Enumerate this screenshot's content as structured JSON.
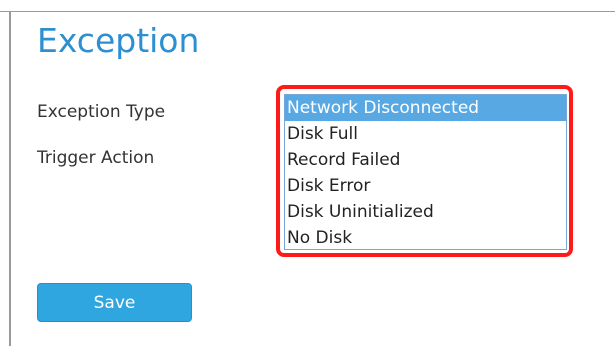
{
  "page": {
    "title": "Exception"
  },
  "form": {
    "exception_type_label": "Exception Type",
    "trigger_action_label": "Trigger Action",
    "exception_type_options": [
      "Network Disconnected",
      "Disk Full",
      "Record Failed",
      "Disk Error",
      "Disk Uninitialized",
      "No Disk"
    ],
    "selected_option": "Network Disconnected",
    "save_label": "Save"
  },
  "colors": {
    "title": "#2c8fd1",
    "selected_option_bg": "#58a9e3",
    "highlight_border": "#ff1a1a",
    "save_button_bg": "#2fa6df"
  }
}
